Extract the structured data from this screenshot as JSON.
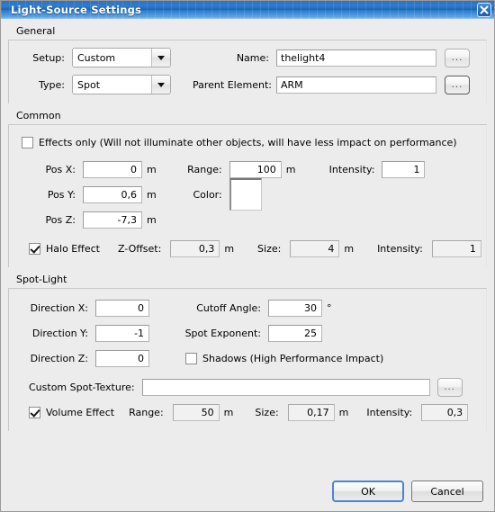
{
  "window": {
    "title": "Light-Source Settings",
    "close_icon": "close-icon"
  },
  "general": {
    "title": "General",
    "setup_label": "Setup:",
    "setup_value": "Custom",
    "type_label": "Type:",
    "type_value": "Spot",
    "name_label": "Name:",
    "name_value": "thelight4",
    "name_browse": "...",
    "parent_label": "Parent Element:",
    "parent_value": "ARM",
    "parent_browse": "..."
  },
  "common": {
    "title": "Common",
    "effects_only_label": "Effects only (Will not illuminate other objects, will have less impact on performance)",
    "effects_only_checked": false,
    "pos_x_label": "Pos X:",
    "pos_x_value": "0",
    "pos_x_unit": "m",
    "pos_y_label": "Pos Y:",
    "pos_y_value": "0,6",
    "pos_y_unit": "m",
    "pos_z_label": "Pos Z:",
    "pos_z_value": "-7,3",
    "pos_z_unit": "m",
    "range_label": "Range:",
    "range_value": "100",
    "range_unit": "m",
    "intensity_label": "Intensity:",
    "intensity_value": "1",
    "color_label": "Color:",
    "color_value": "#ffffff",
    "halo_label": "Halo Effect",
    "halo_checked": true,
    "halo_zoffset_label": "Z-Offset:",
    "halo_zoffset_value": "0,3",
    "halo_zoffset_unit": "m",
    "halo_size_label": "Size:",
    "halo_size_value": "4",
    "halo_size_unit": "m",
    "halo_intensity_label": "Intensity:",
    "halo_intensity_value": "1"
  },
  "spotlight": {
    "title": "Spot-Light",
    "dir_x_label": "Direction X:",
    "dir_x_value": "0",
    "dir_y_label": "Direction Y:",
    "dir_y_value": "-1",
    "dir_z_label": "Direction Z:",
    "dir_z_value": "0",
    "cutoff_label": "Cutoff Angle:",
    "cutoff_value": "30",
    "cutoff_unit": "°",
    "exponent_label": "Spot Exponent:",
    "exponent_value": "25",
    "shadows_label": "Shadows (High Performance Impact)",
    "shadows_checked": false,
    "texture_label": "Custom Spot-Texture:",
    "texture_value": "",
    "texture_browse": "...",
    "volume_label": "Volume Effect",
    "volume_checked": true,
    "volume_range_label": "Range:",
    "volume_range_value": "50",
    "volume_range_unit": "m",
    "volume_size_label": "Size:",
    "volume_size_value": "0,17",
    "volume_size_unit": "m",
    "volume_intensity_label": "Intensity:",
    "volume_intensity_value": "0,3"
  },
  "footer": {
    "ok_label": "OK",
    "cancel_label": "Cancel"
  }
}
